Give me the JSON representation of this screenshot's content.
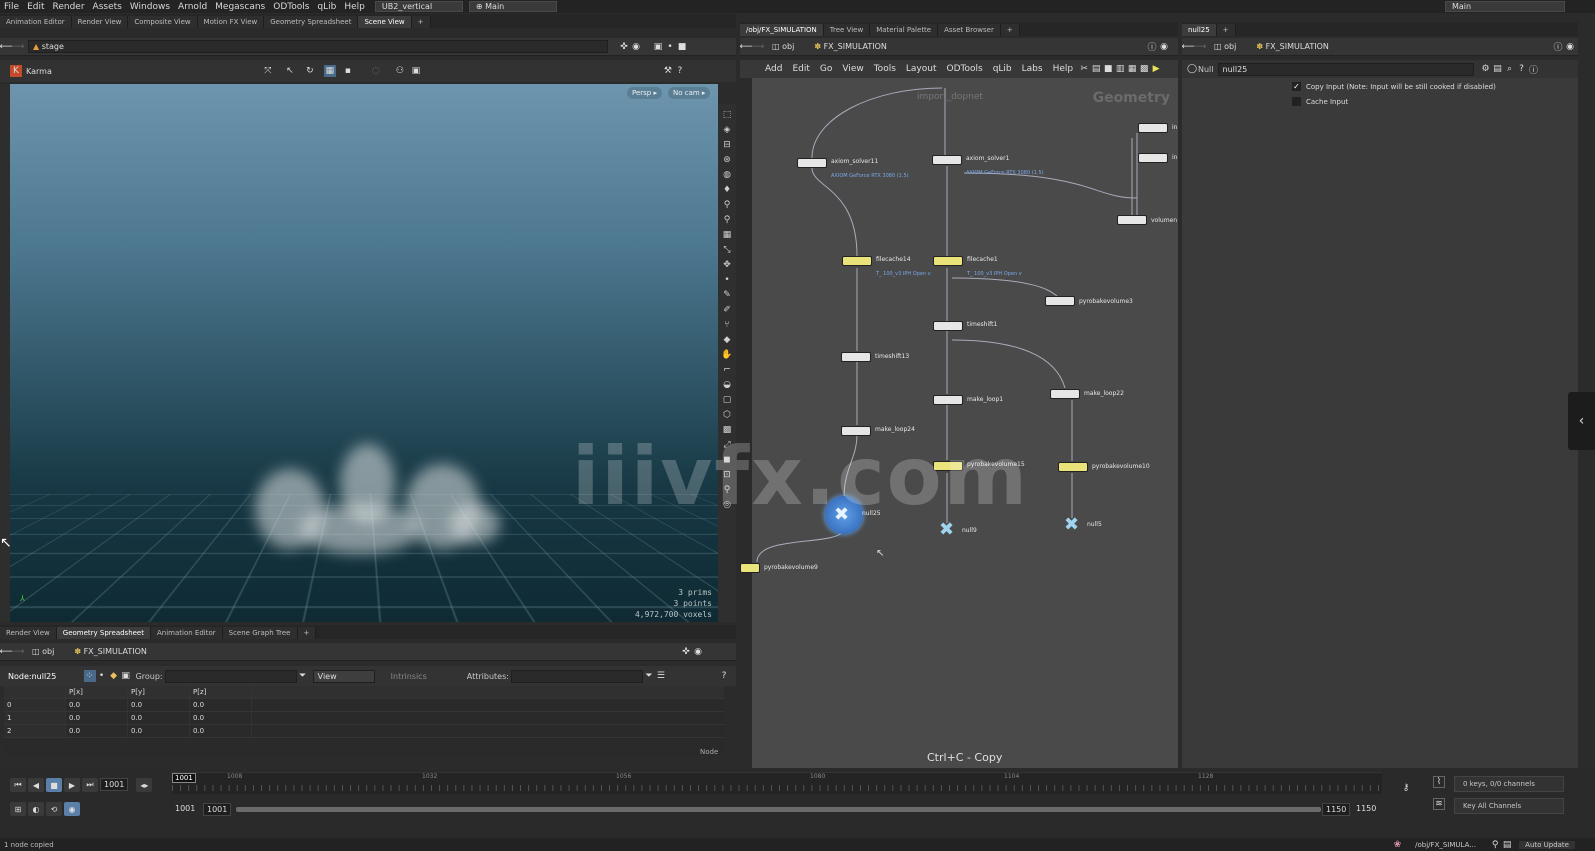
{
  "menubar": {
    "items": [
      "File",
      "Edit",
      "Render",
      "Assets",
      "Windows",
      "Arnold",
      "Megascans",
      "ODTools",
      "qLib",
      "Help"
    ],
    "desktop": "UB2_vertical",
    "context": "Main",
    "right_context": "Main"
  },
  "left_pane": {
    "tabs": [
      "Animation Editor",
      "Render View",
      "Composite View",
      "Motion FX View",
      "Geometry Spreadsheet",
      "Scene View"
    ],
    "path": "stage",
    "renderer": "Karma",
    "viewport": {
      "camera_menu": "Persp ▸",
      "cam_menu": "No cam ▸",
      "stats": [
        "3  prims",
        "3 points",
        "4,972,700 voxels"
      ]
    }
  },
  "bottom_left": {
    "tabs": [
      "Render View",
      "Geometry Spreadsheet",
      "Animation Editor",
      "Scene Graph Tree"
    ],
    "path_root": "obj",
    "path_node": "FX_SIMULATION",
    "node_label": "Node:",
    "node_value": "null25",
    "group_label": "Group:",
    "view_label": "View",
    "intrinsics_label": "Intrinsics",
    "attributes_label": "Attributes:",
    "columns": [
      "",
      "P[x]",
      "P[y]",
      "P[z]"
    ],
    "rows": [
      [
        "0",
        "0.0",
        "0.0",
        "0.0"
      ],
      [
        "1",
        "0.0",
        "0.0",
        "0.0"
      ],
      [
        "2",
        "0.0",
        "0.0",
        "0.0"
      ]
    ],
    "mode_label": "Node"
  },
  "network": {
    "tabs": [
      "/obj/FX_SIMULATION",
      "Tree View",
      "Material Palette",
      "Asset Browser"
    ],
    "path_root": "obj",
    "path_node": "FX_SIMULATION",
    "menu": [
      "Add",
      "Edit",
      "Go",
      "View",
      "Tools",
      "Layout",
      "ODTools",
      "qLib",
      "Labs",
      "Help"
    ],
    "context_label": "Geometry",
    "top_label": "import_dopnet",
    "hint": "Ctrl+C - Copy",
    "nodes": [
      {
        "label": "axiom_solver11",
        "sub": "AXIOM GeForce RTX 3080 (1.5)"
      },
      {
        "label": "axiom_solver1",
        "sub": "AXIOM GeForce RTX 3080 (1.5)"
      },
      {
        "label": "filecache14",
        "sub": "T_ 100_v3 IPH Open v"
      },
      {
        "label": "filecache1",
        "sub": "T_ 100_v3 IPH Open v"
      },
      {
        "label": "pyrobakevolume3",
        "sub": ""
      },
      {
        "label": "timeshift13",
        "sub": ""
      },
      {
        "label": "timeshift1",
        "sub": ""
      },
      {
        "label": "make_loop24",
        "sub": ""
      },
      {
        "label": "make_loop1",
        "sub": ""
      },
      {
        "label": "make_loop22",
        "sub": ""
      },
      {
        "label": "pyrobakevolume15",
        "sub": ""
      },
      {
        "label": "pyrobakevolume10",
        "sub": ""
      },
      {
        "label": "null25",
        "sub": ""
      },
      {
        "label": "null9",
        "sub": ""
      },
      {
        "label": "null5",
        "sub": ""
      },
      {
        "label": "pyrobakevolume9",
        "sub": ""
      },
      {
        "label": "volumen",
        "sub": ""
      },
      {
        "label": "in",
        "sub": ""
      },
      {
        "label": "in",
        "sub": ""
      }
    ]
  },
  "params": {
    "tab": "null25",
    "path_root": "obj",
    "path_node": "FX_SIMULATION",
    "node_type": "Null",
    "node_name": "null25",
    "copy_input": "Copy Input (Note: Input will be still cooked if disabled)",
    "cache_input": "Cache Input"
  },
  "watermark": "iiivfx.com",
  "timeline": {
    "current_frame": "1001",
    "playhead_label": "1001",
    "ticks": [
      "1008",
      "1032",
      "1056",
      "1080",
      "1104",
      "1128"
    ],
    "start": "1001",
    "start2": "1001",
    "end": "1150",
    "end2": "1150",
    "keys_info": "0 keys, 0/0 channels",
    "channels": "Key All Channels"
  },
  "status": {
    "message": "1 node copied",
    "path": "/obj/FX_SIMULA...",
    "update_mode": "Auto Update"
  }
}
